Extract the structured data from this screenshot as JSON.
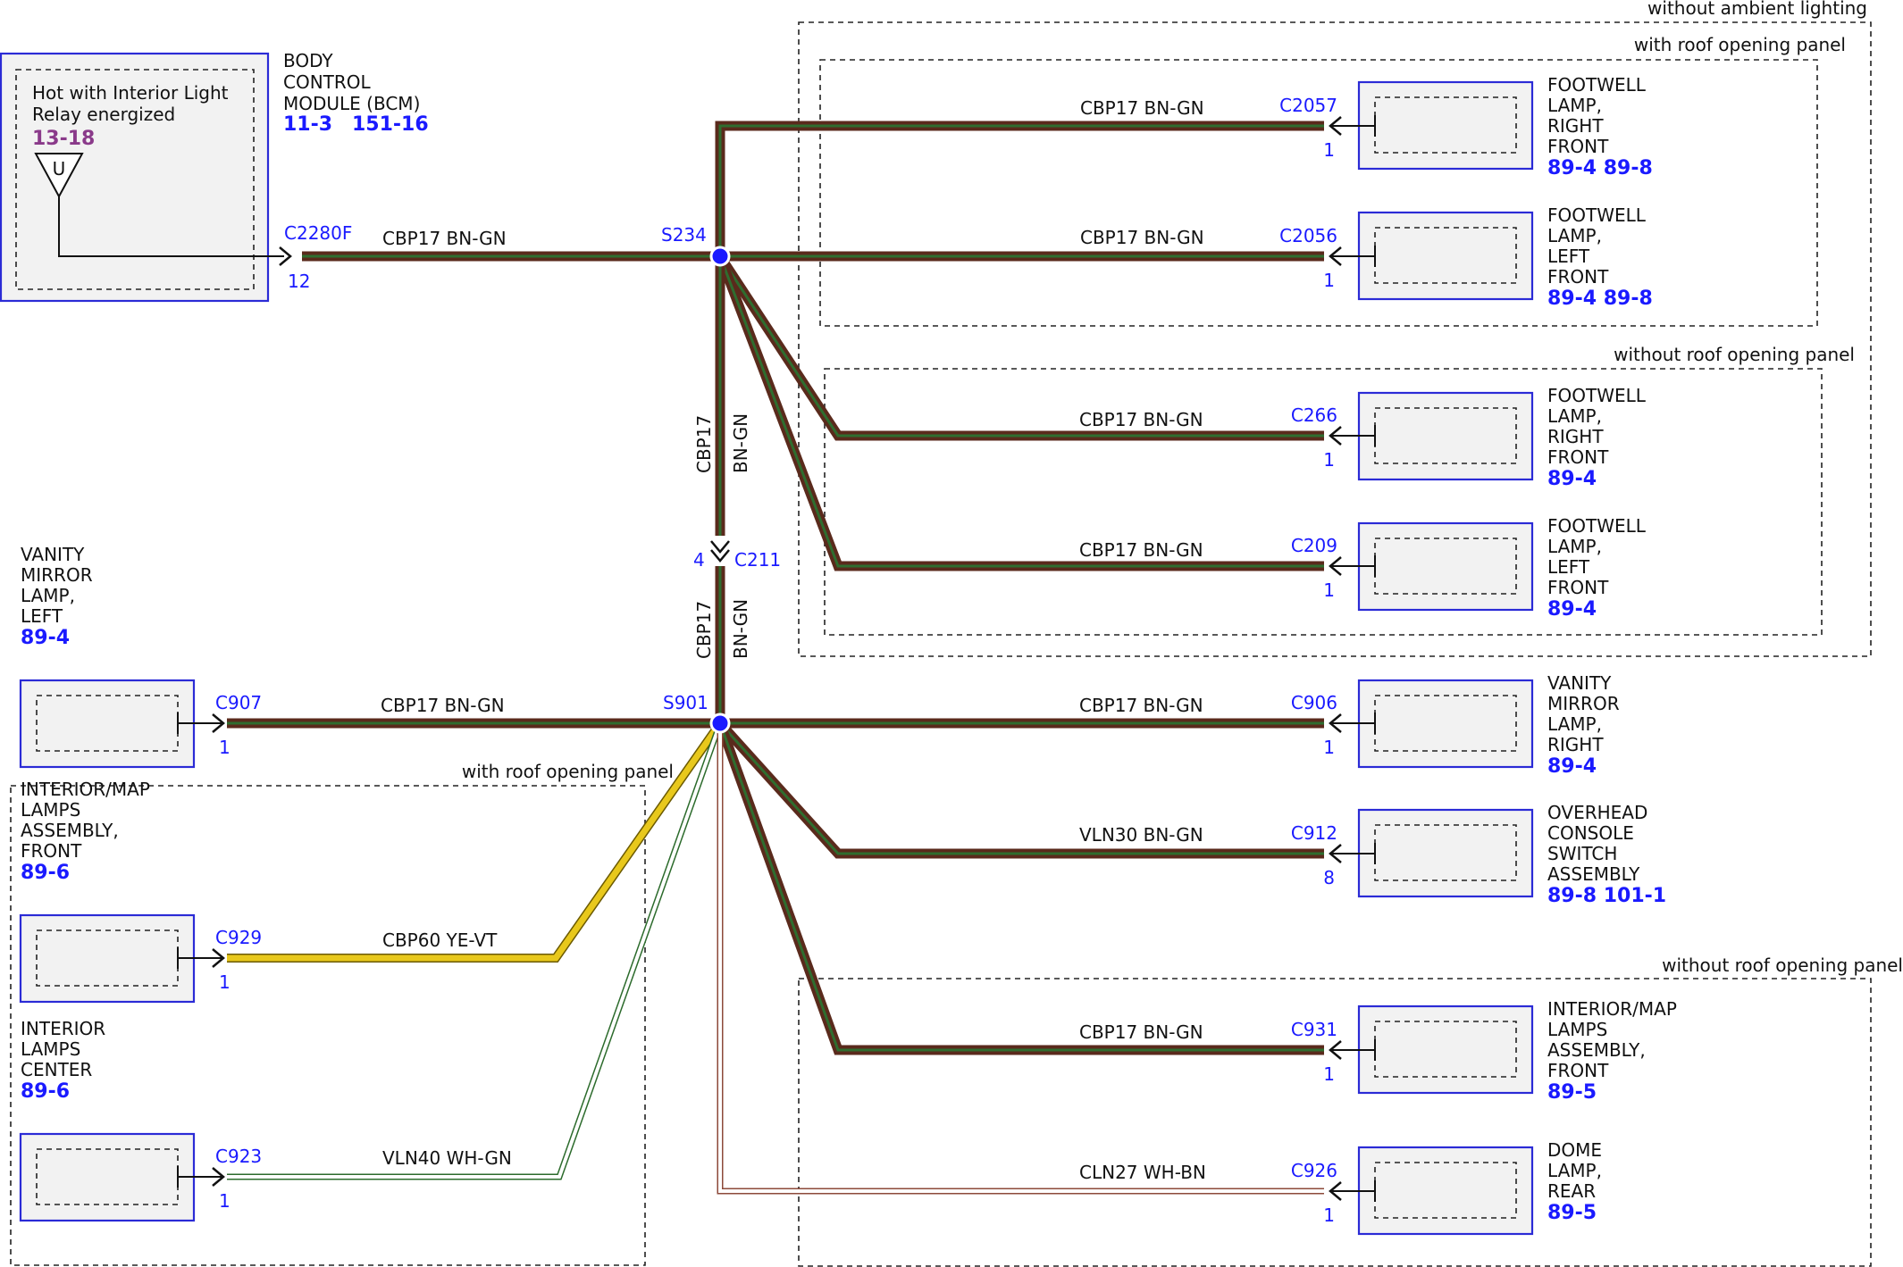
{
  "colors": {
    "bn_gn_outer": "#5a2a1c",
    "bn_gn_inner": "#2f6d2f",
    "ye_vt": "#e8c81c",
    "wh_gn": "#2c6b2c",
    "wh_bn": "#8c4a3a",
    "connector_blue": "#1a1aff",
    "module_border": "#2b2bd6"
  },
  "zones": {
    "without_ambient": "without ambient lighting",
    "with_roof_top": "with roof opening panel",
    "without_roof_top": "without roof opening panel",
    "with_roof_left": "with roof opening panel",
    "without_roof_bottom": "without roof opening panel"
  },
  "bcm": {
    "name": [
      "BODY",
      "CONTROL",
      "MODULE (BCM)"
    ],
    "refs": [
      "11-3",
      "151-16"
    ],
    "inner_text": [
      "Hot with Interior Light",
      "Relay energized"
    ],
    "inner_ref": "13-18",
    "symbol": "U",
    "connector": "C2280F",
    "pin": "12"
  },
  "splices": {
    "s234": "S234",
    "s901": "S901"
  },
  "inline_connector": {
    "id": "C211",
    "pin": "4"
  },
  "wires": {
    "bcm_to_s234": "CBP17  BN-GN",
    "c2057": "CBP17  BN-GN",
    "c2056": "CBP17  BN-GN",
    "c266": "CBP17  BN-GN",
    "c209": "CBP17  BN-GN",
    "vertical_circuit": "CBP17",
    "vertical_color": "BN-GN",
    "c907": "CBP17  BN-GN",
    "c906": "CBP17  BN-GN",
    "c912": "VLN30  BN-GN",
    "c929": "CBP60  YE-VT",
    "c923": "VLN40  WH-GN",
    "c931": "CBP17  BN-GN",
    "c926": "CLN27  WH-BN"
  },
  "components": {
    "c2057": {
      "connector": "C2057",
      "pin": "1",
      "name": [
        "FOOTWELL",
        "LAMP,",
        "RIGHT",
        "FRONT"
      ],
      "refs": "89-4  89-8"
    },
    "c2056": {
      "connector": "C2056",
      "pin": "1",
      "name": [
        "FOOTWELL",
        "LAMP,",
        "LEFT",
        "FRONT"
      ],
      "refs": "89-4  89-8"
    },
    "c266": {
      "connector": "C266",
      "pin": "1",
      "name": [
        "FOOTWELL",
        "LAMP,",
        "RIGHT",
        "FRONT"
      ],
      "refs": "89-4"
    },
    "c209": {
      "connector": "C209",
      "pin": "1",
      "name": [
        "FOOTWELL",
        "LAMP,",
        "LEFT",
        "FRONT"
      ],
      "refs": "89-4"
    },
    "c906": {
      "connector": "C906",
      "pin": "1",
      "name": [
        "VANITY",
        "MIRROR",
        "LAMP,",
        "RIGHT"
      ],
      "refs": "89-4"
    },
    "c912": {
      "connector": "C912",
      "pin": "8",
      "name": [
        "OVERHEAD",
        "CONSOLE",
        "SWITCH",
        "ASSEMBLY"
      ],
      "refs": "89-8  101-1"
    },
    "c931": {
      "connector": "C931",
      "pin": "1",
      "name": [
        "INTERIOR/MAP",
        "LAMPS",
        "ASSEMBLY,",
        "FRONT"
      ],
      "refs": "89-5"
    },
    "c926": {
      "connector": "C926",
      "pin": "1",
      "name": [
        "DOME",
        "LAMP,",
        "REAR"
      ],
      "refs": "89-5"
    },
    "c907": {
      "connector": "C907",
      "pin": "1",
      "name": [
        "VANITY",
        "MIRROR",
        "LAMP,",
        "LEFT"
      ],
      "refs": "89-4"
    },
    "c929": {
      "connector": "C929",
      "pin": "1",
      "name": [
        "INTERIOR/MAP",
        "LAMPS",
        "ASSEMBLY,",
        "FRONT"
      ],
      "refs": "89-6"
    },
    "c923": {
      "connector": "C923",
      "pin": "1",
      "name": [
        "INTERIOR",
        "LAMPS",
        "CENTER"
      ],
      "refs": "89-6"
    }
  }
}
